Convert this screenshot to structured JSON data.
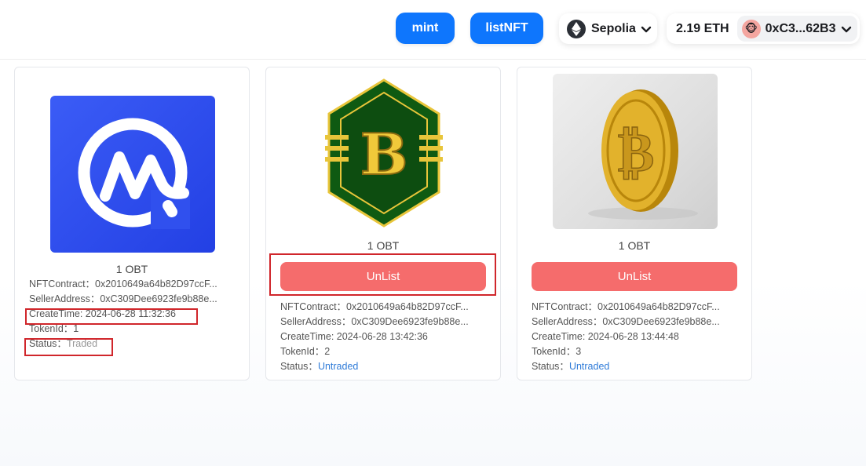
{
  "header": {
    "mint_label": "mint",
    "list_label": "listNFT",
    "network": "Sepolia",
    "balance": "2.19 ETH",
    "account": "0xC3...62B3"
  },
  "colors": {
    "primary_blue": "#0e76fd",
    "unlist_red": "#f56c6c",
    "highlight_red": "#d0262b",
    "untraded_blue": "#2f7bd8"
  },
  "cards": [
    {
      "image": "coinmarketcap-logo",
      "amount": "1 OBT",
      "show_unlist": false,
      "contract_key": "NFTContract：",
      "contract": "0x2010649a64b82D97ccF...",
      "seller_key": "SellerAddress：",
      "seller": "0xC309Dee6923fe9b88e...",
      "create_key": "CreateTime: ",
      "create_time": "2024-06-28 11:32:36",
      "token_key": "TokenId：",
      "token_id": "1",
      "status_key": "Status：",
      "status": "Traded"
    },
    {
      "image": "hexagon-b-coin",
      "amount": "1 OBT",
      "unlist_label": "UnList",
      "contract_key": "NFTContract：",
      "contract": "0x2010649a64b82D97ccF...",
      "seller_key": "SellerAddress：",
      "seller": "0xC309Dee6923fe9b88e...",
      "create_key": "CreateTime: ",
      "create_time": "2024-06-28 13:42:36",
      "token_key": "TokenId：",
      "token_id": "2",
      "status_key": "Status：",
      "status": "Untraded"
    },
    {
      "image": "gold-coin",
      "amount": "1 OBT",
      "unlist_label": "UnList",
      "contract_key": "NFTContract：",
      "contract": "0x2010649a64b82D97ccF...",
      "seller_key": "SellerAddress：",
      "seller": "0xC309Dee6923fe9b88e...",
      "create_key": "CreateTime: ",
      "create_time": "2024-06-28 13:44:48",
      "token_key": "TokenId：",
      "token_id": "3",
      "status_key": "Status：",
      "status": "Untraded"
    }
  ]
}
